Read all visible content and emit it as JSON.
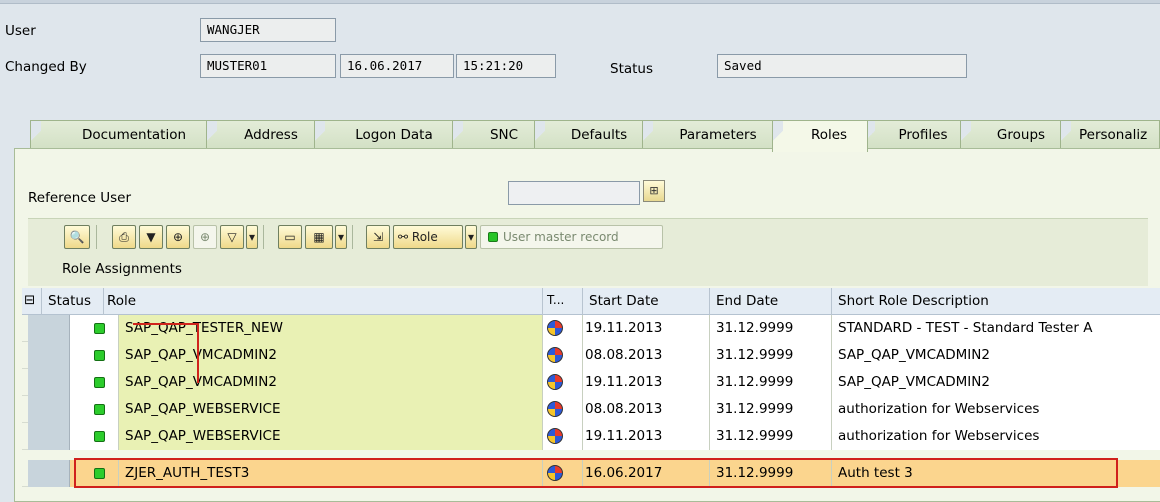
{
  "header": {
    "user_label": "User",
    "user_value": "WANGJER",
    "changed_by_label": "Changed By",
    "changed_by_value": "MUSTER01",
    "changed_date": "16.06.2017",
    "changed_time": "15:21:20",
    "status_label": "Status",
    "status_value": "Saved"
  },
  "tabs": [
    "Documentation",
    "Address",
    "Logon Data",
    "SNC",
    "Defaults",
    "Parameters",
    "Roles",
    "Profiles",
    "Groups",
    "Personaliz"
  ],
  "active_tab": "Roles",
  "reference_user": {
    "label": "Reference User",
    "value": ""
  },
  "toolbar": {
    "role_label": "Role",
    "user_master_record_label": "User master record"
  },
  "section_title": "Role Assignments",
  "table": {
    "columns": [
      "Status",
      "Role",
      "T...",
      "Start Date",
      "End Date",
      "Short Role Description"
    ],
    "rows": [
      {
        "role": "SAP_QAP_TESTER_NEW",
        "start": "19.11.2013",
        "end": "31.12.9999",
        "desc": "STANDARD - TEST - Standard Tester A"
      },
      {
        "role": "SAP_QAP_VMCADMIN2",
        "start": "08.08.2013",
        "end": "31.12.9999",
        "desc": "SAP_QAP_VMCADMIN2"
      },
      {
        "role": "SAP_QAP_VMCADMIN2",
        "start": "19.11.2013",
        "end": "31.12.9999",
        "desc": "SAP_QAP_VMCADMIN2"
      },
      {
        "role": "SAP_QAP_WEBSERVICE",
        "start": "08.08.2013",
        "end": "31.12.9999",
        "desc": "authorization for Webservices"
      },
      {
        "role": "SAP_QAP_WEBSERVICE",
        "start": "19.11.2013",
        "end": "31.12.9999",
        "desc": "authorization for Webservices"
      },
      {
        "role": "ZJER_AUTH_TEST3",
        "start": "16.06.2017",
        "end": "31.12.9999",
        "desc": "Auth test 3"
      }
    ],
    "highlighted_row": 5
  },
  "colors": {
    "status_green": "#2ccc2c",
    "role_cell": "#e9f1b4",
    "highlight": "#fbd58e",
    "annotation_red": "#d0201c"
  }
}
